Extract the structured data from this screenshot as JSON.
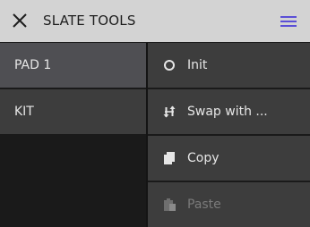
{
  "header": {
    "title": "SLATE TOOLS",
    "close_icon": "close-icon",
    "menu_icon": "hamburger-menu-icon",
    "accent_color": "#5b4fd6",
    "background": "#d3d3d3"
  },
  "left_menu": {
    "items": [
      {
        "label": "PAD 1",
        "selected": true
      },
      {
        "label": "KIT",
        "selected": false
      }
    ]
  },
  "right_menu": {
    "items": [
      {
        "label": "Init",
        "icon": "circle-icon",
        "enabled": true
      },
      {
        "label": "Swap with ...",
        "icon": "swap-icon",
        "enabled": true
      },
      {
        "label": "Copy",
        "icon": "copy-icon",
        "enabled": true
      },
      {
        "label": "Paste",
        "icon": "paste-icon",
        "enabled": false
      }
    ]
  }
}
